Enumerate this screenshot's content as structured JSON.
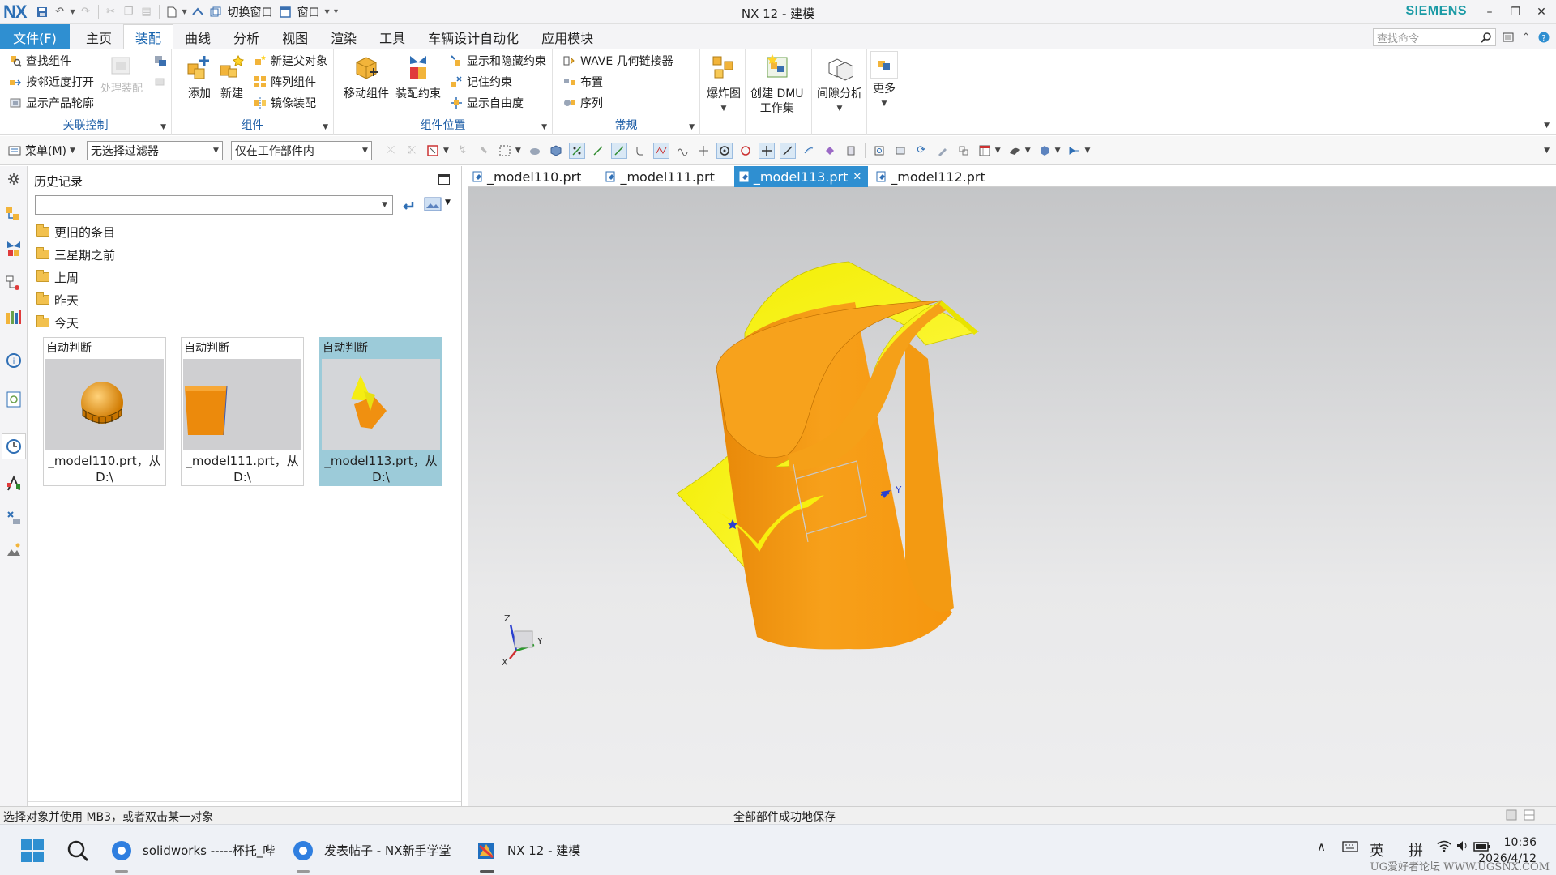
{
  "titlebar": {
    "logo": "NX",
    "switch_window": "切换窗口",
    "window_menu": "窗口",
    "title": "NX 12 - 建模",
    "brand": "SIEMENS"
  },
  "tabs": {
    "file": "文件(F)",
    "items": [
      "主页",
      "装配",
      "曲线",
      "分析",
      "视图",
      "渲染",
      "工具",
      "车辆设计自动化",
      "应用模块"
    ],
    "active_index": 1,
    "search_placeholder": "查找命令"
  },
  "ribbon": {
    "group_relation": {
      "title": "关联控制",
      "find_component": "查找组件",
      "open_by_proximity": "按邻近度打开",
      "show_product_outline": "显示产品轮廓",
      "process_assembly": "处理装配"
    },
    "group_component": {
      "title": "组件",
      "add": "添加",
      "new": "新建",
      "new_parent": "新建父对象",
      "array_component": "阵列组件",
      "mirror_assembly": "镜像装配"
    },
    "group_position": {
      "title": "组件位置",
      "move_component": "移动组件",
      "assembly_constraint": "装配约束",
      "show_hide_constraints": "显示和隐藏约束",
      "remember_constraint": "记住约束",
      "show_dof": "显示自由度"
    },
    "group_general": {
      "title": "常规",
      "wave": "WAVE 几何链接器",
      "arrangement": "布置",
      "sequence": "序列"
    },
    "exploded_view": "爆炸图",
    "create_dmu_1": "创建 DMU",
    "create_dmu_2": "工作集",
    "clearance": "间隙分析",
    "more": "更多"
  },
  "selection_bar": {
    "menu": "菜单(M)",
    "filter": "无选择过滤器",
    "scope": "仅在工作部件内"
  },
  "history": {
    "title": "历史记录",
    "folders": [
      "更旧的条目",
      "三星期之前",
      "上周",
      "昨天",
      "今天"
    ],
    "cards": [
      {
        "header": "自动判断",
        "caption_1": "_model110.prt，从",
        "caption_2": "D:\\"
      },
      {
        "header": "自动判断",
        "caption_1": "_model111.prt，从",
        "caption_2": "D:\\"
      },
      {
        "header": "自动判断",
        "caption_1": "_model113.prt，从",
        "caption_2": "D:\\"
      }
    ]
  },
  "graphics_tabs": [
    "_model110.prt",
    "_model111.prt",
    "_model113.prt",
    "_model112.prt"
  ],
  "graphics_active_index": 2,
  "axes": {
    "x": "X",
    "y": "Y",
    "z": "Z"
  },
  "status": {
    "left": "选择对象并使用 MB3，或者双击某一对象",
    "center": "全部部件成功地保存"
  },
  "taskbar": {
    "apps": [
      "solidworks -----杯托_哔",
      "发表帖子 - NX新手学堂",
      "NX 12 - 建模"
    ],
    "ime_lang": "英",
    "ime_mode": "拼",
    "time": "10:36",
    "date": "2026/4/12",
    "watermark": "UG爱好者论坛 WWW.UGSNX.COM"
  },
  "colors": {
    "accent": "#2f8fd1",
    "ribbon_title": "#1f5fa7",
    "brand": "#1a9aa5",
    "model_orange": "#f29a0f",
    "model_yellow": "#f7f20a",
    "selected_card": "#9ccbd9"
  }
}
